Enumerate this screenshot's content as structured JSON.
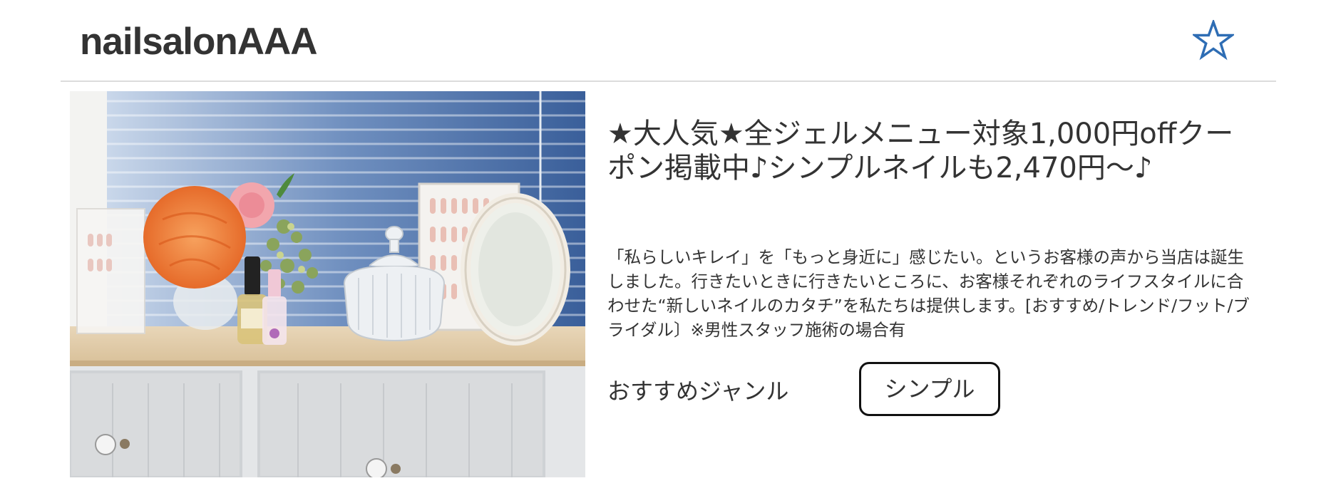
{
  "header": {
    "salon_name": "nailsalonAAA",
    "favorite_icon": "star-outline-icon",
    "favorite_color": "#2e6db4"
  },
  "photo": {
    "subject": "salon interior with flowers, nail polish, glass jar and mirror on cabinet"
  },
  "main": {
    "headline": "★大人気★全ジェルメニュー対象1,000円offクーポン掲載中♪シンプルネイルも2,470円〜♪",
    "description": "「私らしいキレイ」を「もっと身近に」感じたい。というお客様の声から当店は誕生しました。行きたいときに行きたいところに、お客様それぞれのライフスタイルに合わせた“新しいネイルのカタチ”を私たちは提供します。[おすすめ/トレンド/フット/ブライダル〕※男性スタッフ施術の場合有",
    "genre_label": "おすすめジャンル",
    "genre_tag": "シンプル"
  }
}
